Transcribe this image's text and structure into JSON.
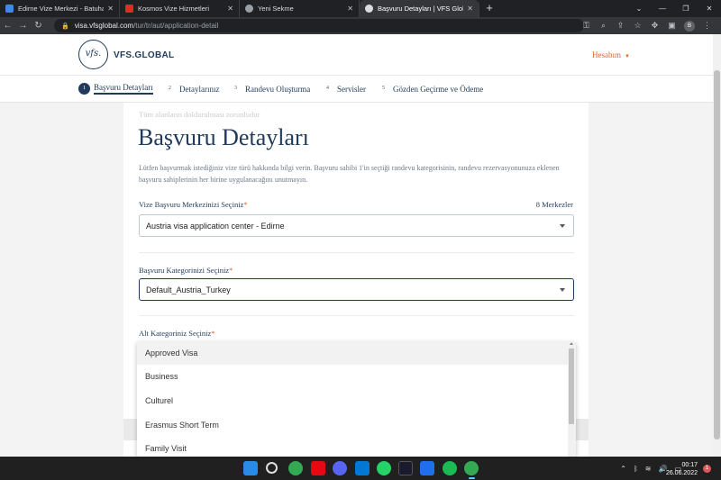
{
  "browser": {
    "tabs": [
      {
        "title": "Edirne Vize Merkezi - Batuhan - C",
        "color": "#4285f4"
      },
      {
        "title": "Kosmos Vize Hizmetleri",
        "color": "#d93025"
      },
      {
        "title": "Yeni Sekme",
        "color": "#9aa0a6"
      },
      {
        "title": "Başvuru Detayları | VFS Global",
        "color": "#dadce0"
      }
    ],
    "url_host": "visa.vfsglobal.com",
    "url_path": "/tur/tr/aut/application-detail"
  },
  "header": {
    "logo_text": "vfs.",
    "brand": "VFS.GLOBAL",
    "account": "Hesabım"
  },
  "steps": [
    {
      "num": "1",
      "label": "Başvuru Detayları"
    },
    {
      "num": "2",
      "label": "Detaylarınız"
    },
    {
      "num": "3",
      "label": "Randevu Oluşturma"
    },
    {
      "num": "4",
      "label": "Servisler"
    },
    {
      "num": "5",
      "label": "Gözden Geçirme ve Ödeme"
    }
  ],
  "form": {
    "notice": "Tüm alanların doldurulması zorunludur",
    "title": "Başvuru Detayları",
    "intro": "Lütfen başvurmak istediğiniz vize türü hakkında bilgi verin. Başvuru sahibi 1'in seçtiği randevu kategorisinin, randevu rezervasyonunuza eklenen başvuru sahiplerinin her birine uygulanacağını unutmayın.",
    "center_label": "Vize Başvuru Merkezinizi Seçiniz",
    "center_count": "8 Merkezler",
    "center_value": "Austria visa application center - Edirne",
    "category_label": "Başvuru Kategorinizi Seçiniz",
    "category_value": "Default_Austria_Turkey",
    "subcategory_label": "Alt Kategoriniz Seçiniz",
    "required_mark": "*"
  },
  "dropdown": {
    "options": [
      "Approved Visa",
      "Business",
      "Culturel",
      "Erasmus Short Term",
      "Family Visit"
    ],
    "highlighted": "Approved Visa"
  },
  "taskbar": {
    "time": "00:17",
    "date": "26.06.2022",
    "notifications": "1"
  }
}
